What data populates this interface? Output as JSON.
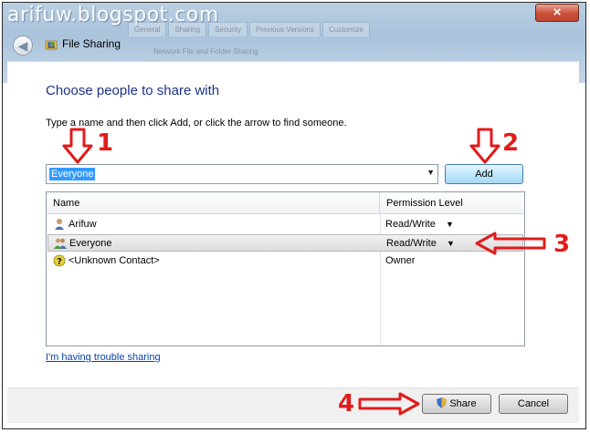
{
  "watermark": "arifuw.blogspot.com",
  "window": {
    "close_glyph": "×",
    "title": "File Sharing",
    "back_glyph": "◀"
  },
  "background_tabs": [
    "General",
    "Sharing",
    "Security",
    "Previous Versions",
    "Customize"
  ],
  "background_subtitle": "Network File and Folder Sharing",
  "heading": "Choose people to share with",
  "instruction": "Type a name and then click Add, or click the arrow to find someone.",
  "name_input": {
    "value": "Everyone",
    "arrow_glyph": "▼"
  },
  "add_button": "Add",
  "table": {
    "headers": {
      "name": "Name",
      "permission": "Permission Level"
    },
    "rows": [
      {
        "name": "Arifuw",
        "permission": "Read/Write",
        "icon": "user-icon",
        "dropdown": "▼"
      },
      {
        "name": "Everyone",
        "permission": "Read/Write",
        "icon": "group-icon",
        "dropdown": "▼",
        "selected": true
      },
      {
        "name": "<Unknown Contact>",
        "permission": "Owner",
        "icon": "unknown-contact-icon"
      }
    ]
  },
  "trouble_link": "I'm having trouble sharing",
  "footer": {
    "share_button": "Share",
    "cancel_button": "Cancel"
  },
  "annotations": {
    "n1": "1",
    "n2": "2",
    "n3": "3",
    "n4": "4"
  },
  "colors": {
    "annotation_red": "#e11b1b",
    "heading_blue": "#1e3287",
    "link_blue": "#0645ad"
  }
}
